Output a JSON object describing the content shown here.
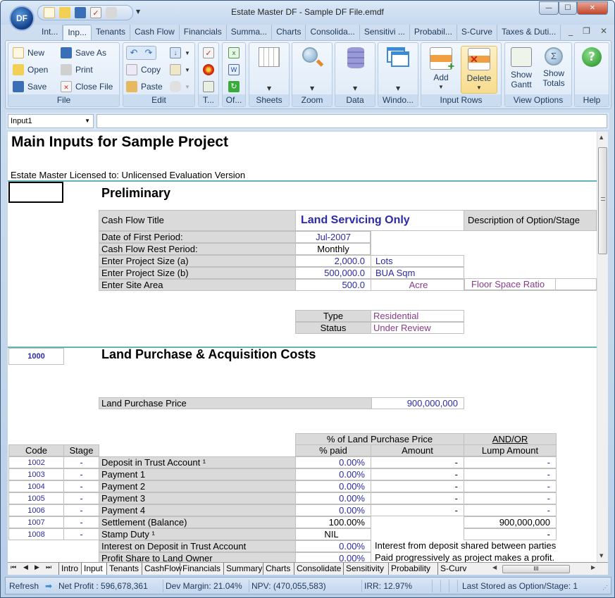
{
  "window": {
    "title": "Estate Master DF - Sample DF File.emdf",
    "app_logo": "DF",
    "controls": {
      "minimize": "—",
      "maximize": "☐",
      "close": "✕"
    }
  },
  "quick_access": [
    "new-icon",
    "open-icon",
    "save-icon",
    "checklist-icon",
    "print-icon"
  ],
  "tabs": [
    {
      "label": "Int...",
      "active": false
    },
    {
      "label": "Inp...",
      "active": true
    },
    {
      "label": "Tenants",
      "active": false
    },
    {
      "label": "Cash Flow",
      "active": false
    },
    {
      "label": "Financials",
      "active": false
    },
    {
      "label": "Summa...",
      "active": false
    },
    {
      "label": "Charts",
      "active": false
    },
    {
      "label": "Consolida...",
      "active": false
    },
    {
      "label": "Sensitivi ...",
      "active": false
    },
    {
      "label": "Probabil...",
      "active": false
    },
    {
      "label": "S-Curve",
      "active": false
    },
    {
      "label": "Taxes & Duti...",
      "active": false
    }
  ],
  "ribbon": {
    "file": {
      "label": "File",
      "new": "New",
      "open": "Open",
      "save": "Save",
      "save_as": "Save As",
      "print": "Print",
      "close_file": "Close File"
    },
    "edit": {
      "label": "Edit",
      "copy": "Copy",
      "paste": "Paste"
    },
    "t": {
      "label": "T..."
    },
    "of": {
      "label": "Of..."
    },
    "sheets": {
      "label": "Sheets"
    },
    "zoom": {
      "label": "Zoom"
    },
    "data": {
      "label": "Data"
    },
    "window": {
      "label": "Windo..."
    },
    "input_rows": {
      "label": "Input Rows",
      "add": "Add",
      "delete": "Delete"
    },
    "view_options": {
      "label": "View Options",
      "show_gantt": "Show Gantt",
      "show_totals": "Show Totals"
    },
    "help": {
      "label": "Help"
    }
  },
  "formula_bar": {
    "name_box": "Input1",
    "formula": ""
  },
  "sheet": {
    "title": "Main Inputs for Sample Project",
    "license": "Estate Master Licensed to: Unlicensed Evaluation Version",
    "preliminary": {
      "heading": "Preliminary",
      "cash_flow_title_label": "Cash Flow Title",
      "cash_flow_title": "Land Servicing Only",
      "description_label": "Description of Option/Stage",
      "rows": [
        {
          "label": "Date of First Period:",
          "value": "Jul-2007",
          "unit": ""
        },
        {
          "label": "Cash Flow Rest Period:",
          "value": "Monthly",
          "unit": ""
        },
        {
          "label": "Enter Project Size (a)",
          "value": "2,000.0",
          "unit": "Lots"
        },
        {
          "label": "Enter Project Size (b)",
          "value": "500,000.0",
          "unit": "BUA Sqm"
        },
        {
          "label": "Enter Site Area",
          "value": "500.0",
          "unit": "Acre"
        }
      ],
      "floor_space_ratio_label": "Floor Space Ratio",
      "type_label": "Type",
      "type_value": "Residential",
      "status_label": "Status",
      "status_value": "Under Review"
    },
    "land": {
      "code": "1000",
      "heading": "Land Purchase & Acquisition Costs",
      "price_label": "Land Purchase Price",
      "price_value": "900,000,000",
      "headers": {
        "code": "Code",
        "stage": "Stage",
        "pct_group": "% of Land Purchase Price",
        "pct_paid": "% paid",
        "amount": "Amount",
        "andor": "AND/OR",
        "lump": "Lump Amount"
      },
      "rows": [
        {
          "code": "1002",
          "stage": "-",
          "label": "Deposit in Trust Account ¹",
          "pct": "0.00%",
          "amount": "-",
          "lump": "-"
        },
        {
          "code": "1003",
          "stage": "-",
          "label": "Payment 1",
          "pct": "0.00%",
          "amount": "-",
          "lump": "-"
        },
        {
          "code": "1004",
          "stage": "-",
          "label": "Payment 2",
          "pct": "0.00%",
          "amount": "-",
          "lump": "-"
        },
        {
          "code": "1005",
          "stage": "-",
          "label": "Payment 3",
          "pct": "0.00%",
          "amount": "-",
          "lump": "-"
        },
        {
          "code": "1006",
          "stage": "-",
          "label": "Payment 4",
          "pct": "0.00%",
          "amount": "-",
          "lump": "-"
        },
        {
          "code": "1007",
          "stage": "-",
          "label": "Settlement (Balance)",
          "pct": "100.00%",
          "amount": "",
          "lump": "900,000,000"
        },
        {
          "code": "1008",
          "stage": "-",
          "label": "Stamp Duty ¹",
          "pct": "NIL",
          "amount": "",
          "lump": "-"
        }
      ],
      "extra_rows": [
        {
          "label": "Interest on Deposit in Trust Account",
          "pct": "0.00%",
          "note": "Interest from deposit shared between parties"
        },
        {
          "label": "Profit Share to Land Owner",
          "pct": "0.00%",
          "note": "Paid progressively as project makes a profit."
        }
      ]
    }
  },
  "sheet_tabs": [
    "Intro",
    "Input",
    "Tenants",
    "CashFlow",
    "Financials",
    "Summary",
    "Charts",
    "Consolidate",
    "Sensitivity",
    "Probability",
    "S-Curv"
  ],
  "active_sheet_tab": "Input",
  "status_bar": {
    "refresh": "Refresh",
    "net_profit": "Net Profit : 596,678,361",
    "dev_margin": "Dev Margin: 21.04%",
    "npv": "NPV: (470,055,583)",
    "irr": "IRR: 12.97%",
    "last_stored": "Last Stored as Option/Stage: 1"
  }
}
